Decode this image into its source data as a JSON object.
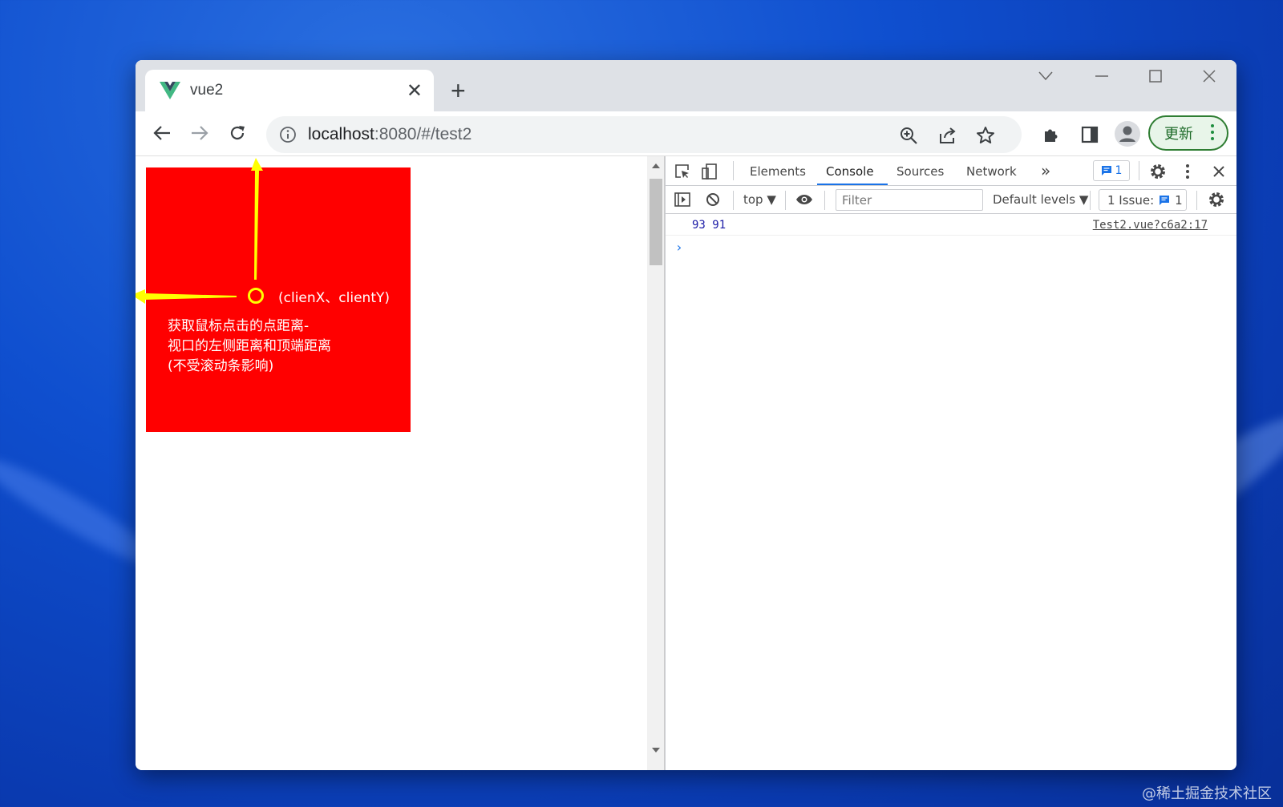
{
  "tab": {
    "title": "vue2",
    "close": "✕",
    "new_tab": "+"
  },
  "toolbar": {
    "url_host": "localhost",
    "url_rest": ":8080/#/test2",
    "update_label": "更新"
  },
  "page": {
    "annotation_coords": "(clienX、clientY)",
    "annotation_lines": [
      "获取鼠标点击的点距离-",
      "视口的左侧距离和顶端距离",
      "(不受滚动条影响)"
    ]
  },
  "devtools": {
    "tabs": [
      "Elements",
      "Console",
      "Sources",
      "Network"
    ],
    "active_tab": "Console",
    "more": "»",
    "message_count": "1",
    "context": "top ▼",
    "filter_placeholder": "Filter",
    "levels": "Default levels ▼",
    "issues_label": "1 Issue:",
    "issues_count": "1",
    "log": {
      "message": "93 91",
      "source": "Test2.vue?c6a2:17"
    },
    "prompt": "›"
  },
  "watermark": "@稀土掘金技术社区",
  "colors": {
    "accent": "#1a73e8",
    "red_box": "#ff0000",
    "annotation": "#ffff00",
    "update_green": "#1e8e3e"
  }
}
